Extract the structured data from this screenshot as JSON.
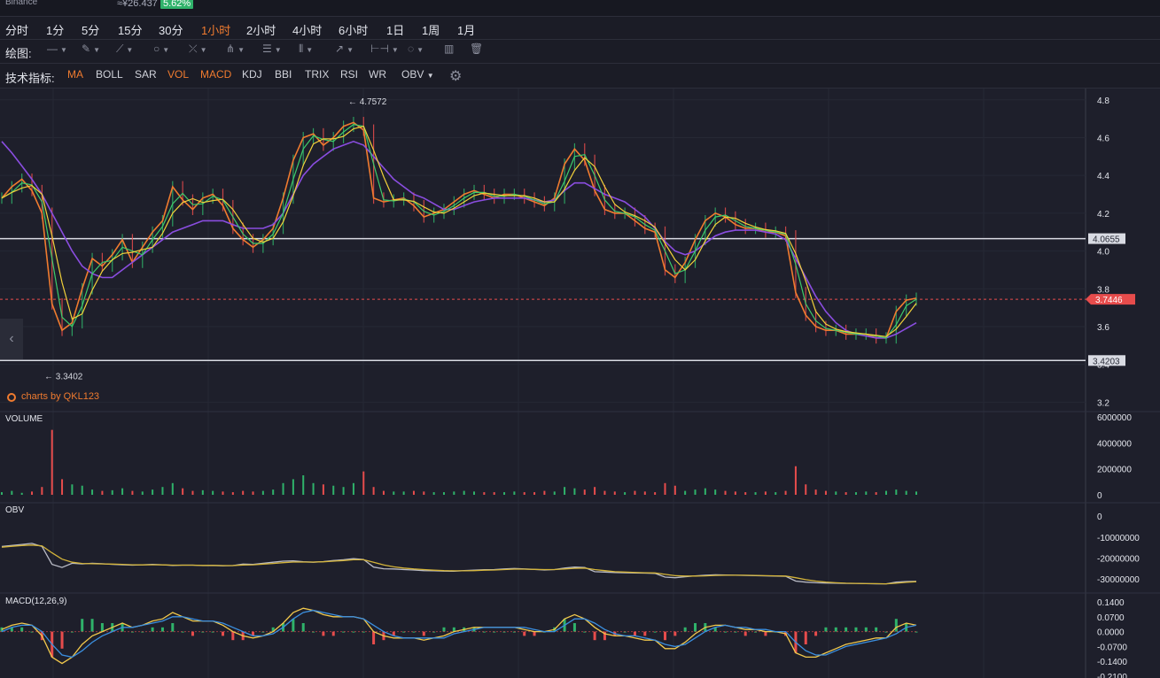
{
  "header": {
    "exchange": "Binance",
    "price_cny": "≈¥26.437",
    "change": "5.62%",
    "change_color": "#2fb26a"
  },
  "timeframes": [
    {
      "label": "分时",
      "active": false
    },
    {
      "label": "1分",
      "active": false
    },
    {
      "label": "5分",
      "active": false
    },
    {
      "label": "15分",
      "active": false
    },
    {
      "label": "30分",
      "active": false
    },
    {
      "label": "1小时",
      "active": true
    },
    {
      "label": "2小时",
      "active": false
    },
    {
      "label": "4小时",
      "active": false
    },
    {
      "label": "6小时",
      "active": false
    },
    {
      "label": "1日",
      "active": false
    },
    {
      "label": "1周",
      "active": false
    },
    {
      "label": "1月",
      "active": false
    }
  ],
  "drawing": {
    "label": "绘图:",
    "tools": [
      "line-tool-icon",
      "pencil-tool-icon",
      "ray-tool-icon",
      "circle-tool-icon",
      "cross-tool-icon",
      "pitchfork-tool-icon",
      "horizontal-lines-tool-icon",
      "vertical-lines-tool-icon",
      "arrow-tool-icon",
      "range-tool-icon",
      "comment-tool-icon",
      "chart-tool-icon",
      "trash-icon"
    ]
  },
  "indicators": {
    "label": "技术指标:",
    "items": [
      {
        "label": "MA",
        "on": true
      },
      {
        "label": "BOLL",
        "on": false
      },
      {
        "label": "SAR",
        "on": false
      },
      {
        "label": "VOL",
        "on": true
      },
      {
        "label": "MACD",
        "on": true
      },
      {
        "label": "KDJ",
        "on": false
      },
      {
        "label": "BBI",
        "on": false
      },
      {
        "label": "TRIX",
        "on": false
      },
      {
        "label": "RSI",
        "on": false
      },
      {
        "label": "WR",
        "on": false
      },
      {
        "label": "OBV",
        "on": false
      }
    ],
    "settings_icon": "gear-icon"
  },
  "chart_data": {
    "type": "candlestick-line",
    "price_axis": [
      "4.8",
      "4.6",
      "4.4",
      "4.2",
      "4.0",
      "3.8",
      "3.6",
      "3.4",
      "3.2"
    ],
    "ylim": [
      3.15,
      4.86
    ],
    "high_label": "← 4.7572",
    "low_label": "← 3.3402",
    "high_value": 4.7572,
    "low_value": 3.3402,
    "hlines": [
      {
        "value": 4.0655,
        "label": "4.0655"
      },
      {
        "value": 3.4203,
        "label": "3.4203"
      }
    ],
    "current_price": {
      "value": 3.7446,
      "label": "3.7446",
      "color": "#e74c4c"
    },
    "series": [
      {
        "name": "close",
        "color": "#f07b2f",
        "values": [
          4.28,
          4.34,
          4.38,
          4.32,
          4.2,
          3.72,
          3.58,
          3.62,
          3.8,
          3.96,
          3.92,
          3.98,
          4.06,
          3.94,
          4.02,
          4.1,
          4.16,
          4.34,
          4.27,
          4.22,
          4.28,
          4.3,
          4.24,
          4.12,
          4.06,
          4.02,
          4.06,
          4.12,
          4.28,
          4.48,
          4.6,
          4.62,
          4.56,
          4.6,
          4.66,
          4.68,
          4.64,
          4.28,
          4.26,
          4.27,
          4.28,
          4.24,
          4.18,
          4.2,
          4.22,
          4.26,
          4.3,
          4.32,
          4.3,
          4.28,
          4.3,
          4.3,
          4.28,
          4.26,
          4.24,
          4.28,
          4.46,
          4.54,
          4.48,
          4.32,
          4.22,
          4.2,
          4.2,
          4.16,
          4.12,
          4.1,
          3.9,
          3.86,
          3.94,
          4.06,
          4.16,
          4.2,
          4.18,
          4.14,
          4.12,
          4.12,
          4.1,
          4.1,
          4.08,
          3.78,
          3.66,
          3.6,
          3.58,
          3.58,
          3.56,
          3.56,
          3.56,
          3.54,
          3.54,
          3.68,
          3.74,
          3.75
        ]
      },
      {
        "name": "MA long",
        "color": "#8a4de0",
        "values": [
          4.58,
          4.52,
          4.45,
          4.38,
          4.3,
          4.2,
          4.1,
          4.0,
          3.92,
          3.88,
          3.86,
          3.86,
          3.9,
          3.94,
          3.98,
          4.02,
          4.06,
          4.1,
          4.12,
          4.14,
          4.16,
          4.16,
          4.16,
          4.14,
          4.12,
          4.12,
          4.12,
          4.14,
          4.2,
          4.3,
          4.4,
          4.46,
          4.5,
          4.54,
          4.56,
          4.58,
          4.56,
          4.5,
          4.44,
          4.38,
          4.34,
          4.3,
          4.28,
          4.25,
          4.22,
          4.22,
          4.24,
          4.26,
          4.27,
          4.28,
          4.28,
          4.28,
          4.28,
          4.27,
          4.26,
          4.27,
          4.32,
          4.36,
          4.36,
          4.33,
          4.3,
          4.28,
          4.26,
          4.22,
          4.18,
          4.12,
          4.05,
          4.0,
          3.98,
          4.0,
          4.04,
          4.08,
          4.1,
          4.11,
          4.11,
          4.11,
          4.1,
          4.09,
          4.06,
          3.96,
          3.86,
          3.76,
          3.68,
          3.62,
          3.58,
          3.56,
          3.55,
          3.54,
          3.54,
          3.56,
          3.59,
          3.62
        ]
      }
    ],
    "volume": {
      "label": "VOLUME",
      "axis": [
        "6000000",
        "4000000",
        "2000000",
        "0"
      ],
      "ylim": [
        0,
        6000000
      ],
      "values": [
        200000,
        300000,
        150000,
        250000,
        600000,
        5000000,
        1200000,
        800000,
        700000,
        400000,
        300000,
        350000,
        500000,
        300000,
        250000,
        400000,
        600000,
        900000,
        500000,
        300000,
        350000,
        300000,
        250000,
        200000,
        300000,
        250000,
        300000,
        400000,
        900000,
        1200000,
        1500000,
        900000,
        800000,
        700000,
        600000,
        900000,
        1800000,
        600000,
        300000,
        250000,
        250000,
        300000,
        250000,
        200000,
        200000,
        250000,
        300000,
        250000,
        200000,
        200000,
        200000,
        250000,
        200000,
        200000,
        300000,
        250000,
        600000,
        500000,
        400000,
        600000,
        300000,
        250000,
        200000,
        300000,
        250000,
        200000,
        900000,
        700000,
        300000,
        400000,
        500000,
        400000,
        300000,
        250000,
        200000,
        200000,
        250000,
        200000,
        300000,
        2200000,
        800000,
        400000,
        300000,
        250000,
        200000,
        200000,
        250000,
        200000,
        300000,
        400000,
        300000,
        250000
      ]
    },
    "obv": {
      "label": "OBV",
      "axis": [
        "0",
        "-10000000",
        "-20000000",
        "-30000000"
      ],
      "ylim": [
        -35000000,
        3000000
      ],
      "series": [
        {
          "name": "OBV",
          "color": "#b9bbc6",
          "values": [
            -14500000,
            -14000000,
            -13500000,
            -13000000,
            -14500000,
            -23000000,
            -24500000,
            -22500000,
            -22800000,
            -22500000,
            -22700000,
            -23000000,
            -23200000,
            -23400000,
            -23200000,
            -23000000,
            -23200000,
            -23500000,
            -23400000,
            -23400000,
            -23600000,
            -23500000,
            -23700000,
            -23600000,
            -22900000,
            -23000000,
            -22500000,
            -22000000,
            -21500000,
            -21300000,
            -21800000,
            -22000000,
            -21700000,
            -21200000,
            -20800000,
            -20300000,
            -20700000,
            -24300000,
            -25100000,
            -25200000,
            -25500000,
            -25700000,
            -26000000,
            -26100000,
            -26200000,
            -26300000,
            -26000000,
            -25800000,
            -25600000,
            -25500000,
            -25200000,
            -25000000,
            -25200000,
            -25400000,
            -25700000,
            -25500000,
            -24800000,
            -24300000,
            -24500000,
            -26500000,
            -26700000,
            -26900000,
            -27000000,
            -27100000,
            -27200000,
            -27300000,
            -29100000,
            -29400000,
            -28900000,
            -28500000,
            -28200000,
            -28000000,
            -28100000,
            -28200000,
            -28300000,
            -28400000,
            -28500000,
            -28600000,
            -28700000,
            -31000000,
            -31500000,
            -31800000,
            -31900000,
            -32000000,
            -32100000,
            -32100000,
            -32200000,
            -32300000,
            -32300000,
            -31500000,
            -31200000,
            -31100000
          ]
        },
        {
          "name": "MAOBV",
          "color": "#d4b43a",
          "values": [
            -14800000,
            -14400000,
            -14000000,
            -13800000,
            -14200000,
            -17500000,
            -20500000,
            -22000000,
            -22600000,
            -22700000,
            -22800000,
            -22900000,
            -23000000,
            -23200000,
            -23250000,
            -23200000,
            -23250000,
            -23400000,
            -23400000,
            -23400000,
            -23500000,
            -23500000,
            -23600000,
            -23600000,
            -23300000,
            -23200000,
            -22900000,
            -22600000,
            -22200000,
            -21900000,
            -21900000,
            -21900000,
            -21800000,
            -21500000,
            -21200000,
            -20800000,
            -20800000,
            -22000000,
            -23300000,
            -24200000,
            -24800000,
            -25200000,
            -25500000,
            -25800000,
            -26000000,
            -26100000,
            -26100000,
            -26000000,
            -25800000,
            -25700000,
            -25500000,
            -25300000,
            -25300000,
            -25400000,
            -25500000,
            -25500000,
            -25200000,
            -24900000,
            -24800000,
            -25500000,
            -26000000,
            -26500000,
            -26700000,
            -26900000,
            -27000000,
            -27100000,
            -27800000,
            -28400000,
            -28600000,
            -28600000,
            -28500000,
            -28300000,
            -28200000,
            -28200000,
            -28200000,
            -28300000,
            -28400000,
            -28500000,
            -28600000,
            -29400000,
            -30300000,
            -31000000,
            -31500000,
            -31800000,
            -32000000,
            -32100000,
            -32200000,
            -32200000,
            -32300000,
            -32000000,
            -31600000,
            -31300000
          ]
        }
      ]
    },
    "macd": {
      "label": "MACD(12,26,9)",
      "axis": [
        "0.1400",
        "0.0700",
        "0.0000",
        "-0.0700",
        "-0.1400",
        "-0.2100"
      ],
      "ylim": [
        -0.21,
        0.14
      ],
      "series": [
        {
          "name": "DIF",
          "color": "#f2c94c",
          "values": [
            0.01,
            0.03,
            0.04,
            0.03,
            -0.02,
            -0.12,
            -0.15,
            -0.12,
            -0.06,
            -0.02,
            0.0,
            0.02,
            0.04,
            0.02,
            0.03,
            0.05,
            0.06,
            0.09,
            0.07,
            0.05,
            0.05,
            0.05,
            0.03,
            0.0,
            -0.02,
            -0.03,
            -0.02,
            0.0,
            0.04,
            0.09,
            0.11,
            0.1,
            0.08,
            0.07,
            0.07,
            0.07,
            0.06,
            0.0,
            -0.02,
            -0.03,
            -0.03,
            -0.03,
            -0.04,
            -0.03,
            -0.02,
            0.0,
            0.01,
            0.02,
            0.02,
            0.02,
            0.02,
            0.02,
            0.01,
            0.0,
            0.0,
            0.01,
            0.06,
            0.08,
            0.06,
            0.02,
            -0.01,
            -0.02,
            -0.02,
            -0.03,
            -0.04,
            -0.04,
            -0.08,
            -0.08,
            -0.05,
            -0.01,
            0.02,
            0.03,
            0.03,
            0.02,
            0.01,
            0.01,
            0.0,
            0.0,
            -0.01,
            -0.1,
            -0.12,
            -0.12,
            -0.1,
            -0.08,
            -0.06,
            -0.05,
            -0.04,
            -0.03,
            -0.03,
            0.02,
            0.04,
            0.03
          ]
        },
        {
          "name": "DEA",
          "color": "#3b8fe0",
          "values": [
            0.0,
            0.02,
            0.03,
            0.03,
            0.0,
            -0.06,
            -0.11,
            -0.12,
            -0.09,
            -0.05,
            -0.02,
            0.0,
            0.02,
            0.02,
            0.03,
            0.04,
            0.05,
            0.07,
            0.07,
            0.06,
            0.05,
            0.05,
            0.04,
            0.02,
            0.0,
            -0.02,
            -0.02,
            -0.01,
            0.02,
            0.06,
            0.09,
            0.1,
            0.09,
            0.08,
            0.07,
            0.07,
            0.06,
            0.03,
            0.0,
            -0.02,
            -0.03,
            -0.03,
            -0.03,
            -0.03,
            -0.03,
            -0.01,
            0.0,
            0.01,
            0.02,
            0.02,
            0.02,
            0.02,
            0.02,
            0.01,
            0.0,
            0.0,
            0.03,
            0.06,
            0.06,
            0.04,
            0.01,
            -0.01,
            -0.02,
            -0.02,
            -0.03,
            -0.04,
            -0.06,
            -0.07,
            -0.06,
            -0.03,
            0.0,
            0.02,
            0.03,
            0.02,
            0.02,
            0.01,
            0.01,
            0.0,
            0.0,
            -0.05,
            -0.09,
            -0.11,
            -0.11,
            -0.09,
            -0.07,
            -0.06,
            -0.05,
            -0.04,
            -0.03,
            -0.01,
            0.02,
            0.03
          ]
        }
      ]
    }
  },
  "branding": {
    "credit": "charts by QKL123",
    "credit_color": "#f07b2f",
    "nav_left": "‹"
  }
}
